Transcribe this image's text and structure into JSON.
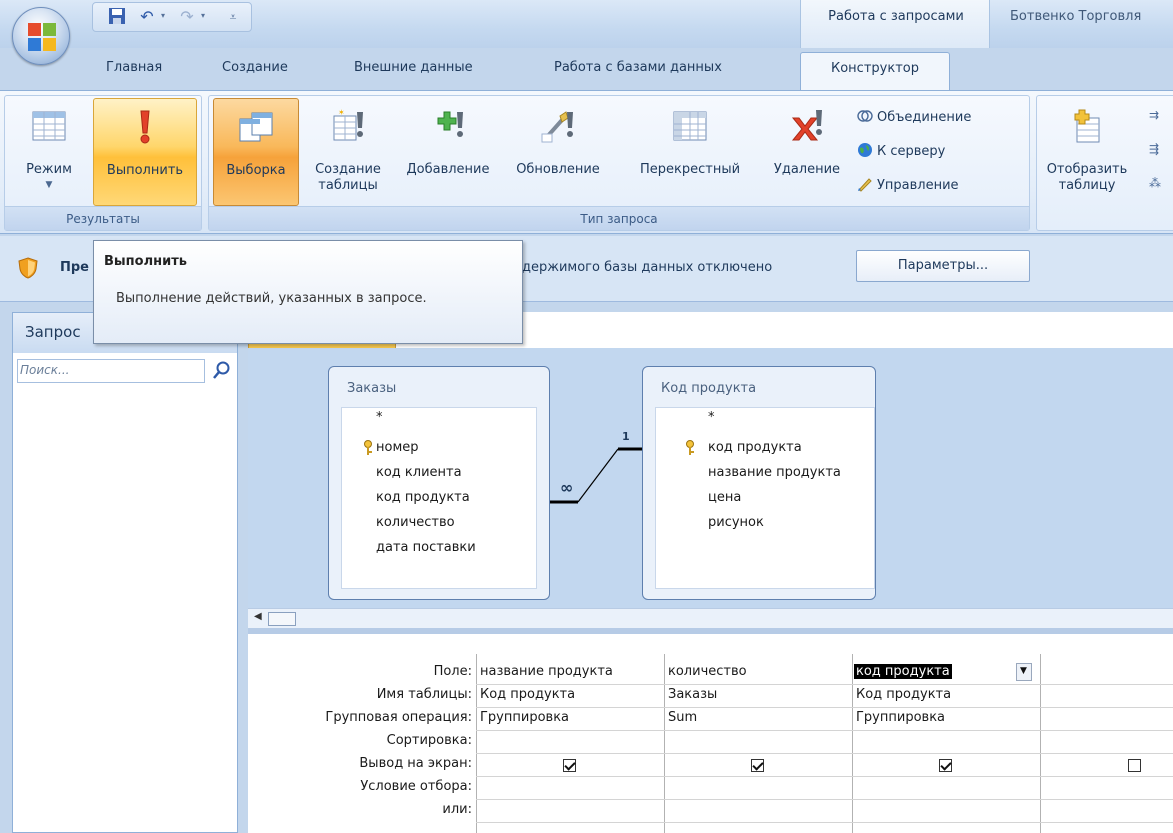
{
  "title_bar": {
    "contextual_tab": "Работа с запросами",
    "window_title": "Ботвенко Торговля"
  },
  "tabs": [
    "Главная",
    "Создание",
    "Внешние данные",
    "Работа с базами данных",
    "Конструктор"
  ],
  "ribbon": {
    "results_group": {
      "label": "Результаты",
      "mode": "Режим",
      "run": "Выполнить"
    },
    "query_type_group": {
      "label": "Тип запроса",
      "select": "Выборка",
      "make_table_line1": "Создание",
      "make_table_line2": "таблицы",
      "append": "Добавление",
      "update": "Обновление",
      "crosstab": "Перекрестный",
      "delete": "Удаление",
      "union": "Объединение",
      "pass_through": "К серверу",
      "data_definition": "Управление"
    },
    "show_table": {
      "line1": "Отобразить",
      "line2": "таблицу"
    }
  },
  "message_bar": {
    "label": "Пре",
    "text": "держимого базы данных отключено",
    "params_button": "Параметры..."
  },
  "tooltip": {
    "title": "Выполнить",
    "body": "Выполнение действий, указанных в запросе."
  },
  "nav_pane": {
    "header": "Запрос",
    "search_placeholder": "Поиск..."
  },
  "tables": [
    {
      "title": "Заказы",
      "fields": [
        "*",
        "номер",
        "код клиента",
        "код продукта",
        "количество",
        "дата поставки"
      ],
      "key_field": "номер"
    },
    {
      "title": "Код продукта",
      "fields": [
        "*",
        "код продукта",
        "название продукта",
        "цена",
        "рисунок"
      ],
      "key_field": "код продукта"
    }
  ],
  "relationship": {
    "one_side": "1",
    "many_side": "∞"
  },
  "grid": {
    "row_labels": [
      "Поле:",
      "Имя таблицы:",
      "Групповая операция:",
      "Сортировка:",
      "Вывод на экран:",
      "Условие отбора:",
      "или:"
    ],
    "columns": [
      {
        "field": "название продукта",
        "table": "Код продукта",
        "total": "Группировка",
        "show": true
      },
      {
        "field": "количество",
        "table": "Заказы",
        "total": "Sum",
        "show": true
      },
      {
        "field": "код продукта",
        "table": "Код продукта",
        "total": "Группировка",
        "show": true
      },
      {
        "field": "",
        "table": "",
        "total": "",
        "show": false
      }
    ]
  },
  "colors": {
    "accent_orange": "#ffc03a",
    "ribbon_blue": "#c3d6ec",
    "text_blue": "#1e395b"
  }
}
